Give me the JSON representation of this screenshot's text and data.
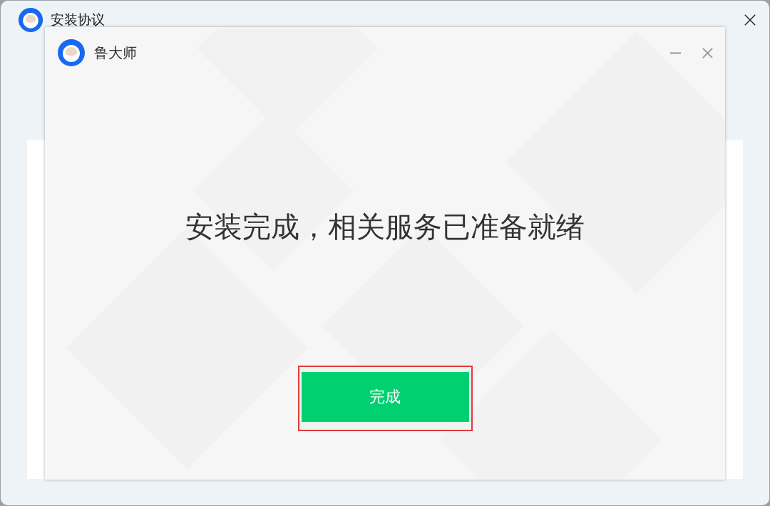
{
  "window": {
    "title": "安装协议"
  },
  "dialog": {
    "title": "鲁大师",
    "message": "安装完成，相关服务已准备就绪",
    "button": {
      "label": "完成",
      "highlighted": true
    }
  }
}
